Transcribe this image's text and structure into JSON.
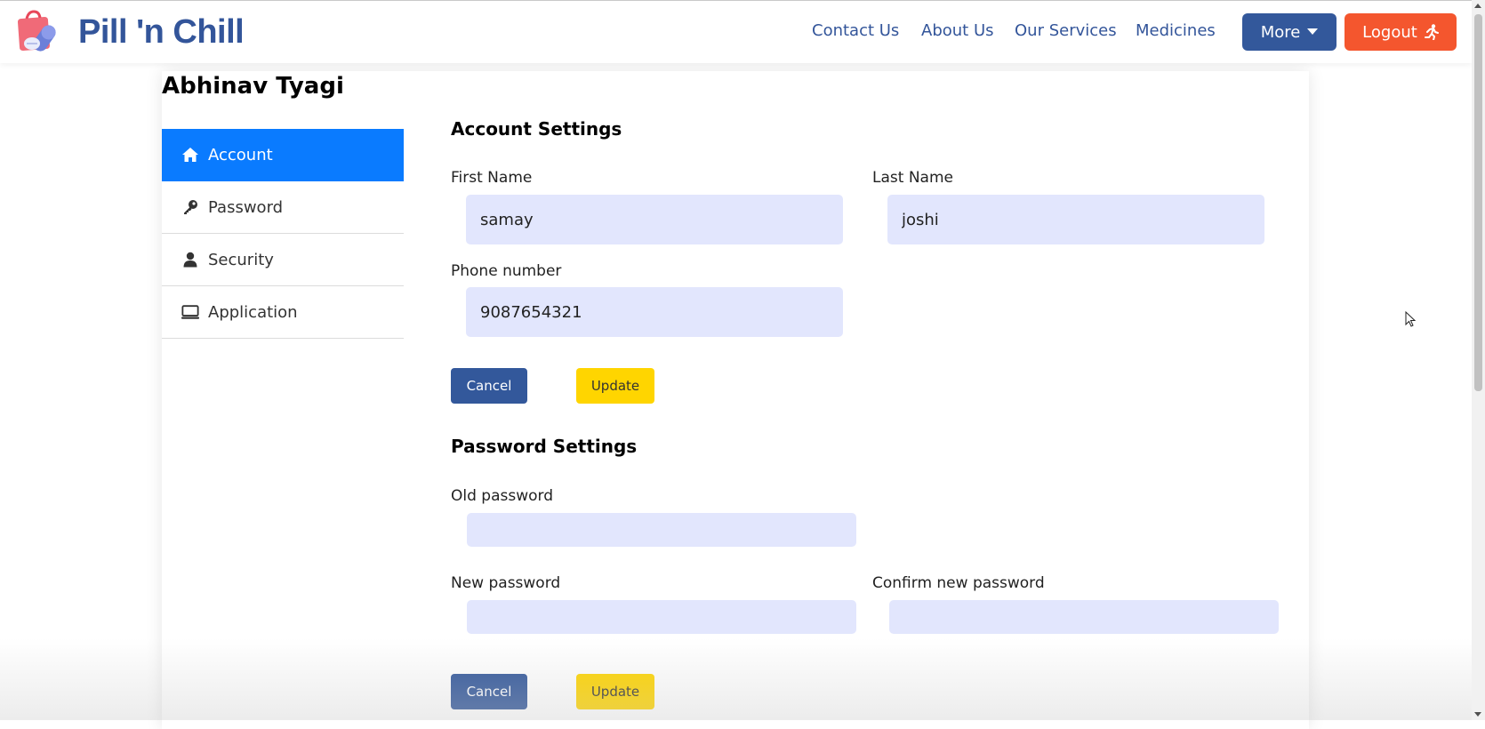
{
  "brand": {
    "name": "Pill 'n Chill"
  },
  "nav": {
    "links": [
      "Contact Us",
      "About Us",
      "Our Services",
      "Medicines"
    ],
    "more_label": "More",
    "logout_label": "Logout"
  },
  "user": {
    "name": "Abhinav Tyagi"
  },
  "sidebar": {
    "items": [
      {
        "label": "Account",
        "icon": "home-icon",
        "active": true
      },
      {
        "label": "Password",
        "icon": "key-icon",
        "active": false
      },
      {
        "label": "Security",
        "icon": "user-icon",
        "active": false
      },
      {
        "label": "Application",
        "icon": "monitor-icon",
        "active": false
      }
    ]
  },
  "account_settings": {
    "title": "Account Settings",
    "first_name_label": "First Name",
    "first_name_value": "samay",
    "last_name_label": "Last Name",
    "last_name_value": "joshi",
    "phone_label": "Phone number",
    "phone_value": "9087654321",
    "cancel_label": "Cancel",
    "update_label": "Update"
  },
  "password_settings": {
    "title": "Password Settings",
    "old_label": "Old password",
    "old_value": "",
    "new_label": "New password",
    "new_value": "",
    "confirm_label": "Confirm new password",
    "confirm_value": "",
    "cancel_label": "Cancel",
    "update_label": "Update"
  },
  "colors": {
    "brand": "#33559a",
    "active": "#0a7bff",
    "logout": "#f4562e",
    "update": "#ffd500",
    "input_bg": "#e2e6fd"
  }
}
